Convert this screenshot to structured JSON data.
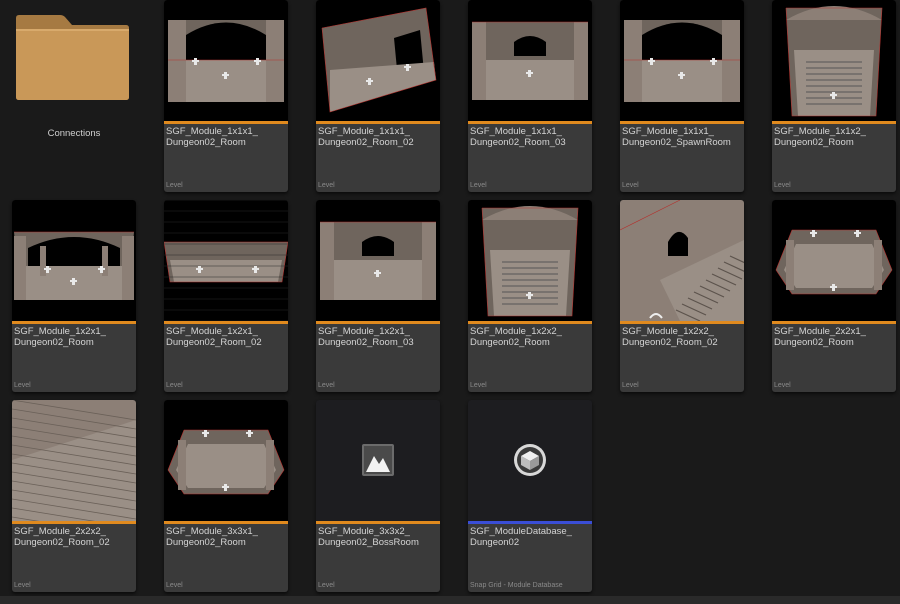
{
  "folder": {
    "label": "Connections",
    "icon": "folder-icon"
  },
  "accent_colors": {
    "level": "#e08a1e",
    "database": "#3a4ed6"
  },
  "assets": [
    {
      "line1": "SGF_Module_1x1x1_",
      "line2": "Dungeon02_Room",
      "type": "Level",
      "thumb": "room-arch"
    },
    {
      "line1": "SGF_Module_1x1x1_",
      "line2": "Dungeon02_Room_02",
      "type": "Level",
      "thumb": "room-tilt"
    },
    {
      "line1": "SGF_Module_1x1x1_",
      "line2": "Dungeon02_Room_03",
      "type": "Level",
      "thumb": "room-pillars"
    },
    {
      "line1": "SGF_Module_1x1x1_",
      "line2": "Dungeon02_SpawnRoom",
      "type": "Level",
      "thumb": "room-arch"
    },
    {
      "line1": "SGF_Module_1x1x2_",
      "line2": "Dungeon02_Room",
      "type": "Level",
      "thumb": "room-tall"
    },
    {
      "line1": "SGF_Module_1x2x1_",
      "line2": "Dungeon02_Room",
      "type": "Level",
      "thumb": "room-colonnade"
    },
    {
      "line1": "SGF_Module_1x2x1_",
      "line2": "Dungeon02_Room_02",
      "type": "Level",
      "thumb": "room-wide"
    },
    {
      "line1": "SGF_Module_1x2x1_",
      "line2": "Dungeon02_Room_03",
      "type": "Level",
      "thumb": "room-pillars"
    },
    {
      "line1": "SGF_Module_1x2x2_",
      "line2": "Dungeon02_Room",
      "type": "Level",
      "thumb": "room-tall"
    },
    {
      "line1": "SGF_Module_1x2x2_",
      "line2": "Dungeon02_Room_02",
      "type": "Level",
      "thumb": "room-stairs"
    },
    {
      "line1": "SGF_Module_2x2x1_",
      "line2": "Dungeon02_Room",
      "type": "Level",
      "thumb": "room-hex"
    },
    {
      "line1": "SGF_Module_2x2x2_",
      "line2": "Dungeon02_Room_02",
      "type": "Level",
      "thumb": "room-closeup"
    },
    {
      "line1": "SGF_Module_3x3x1_",
      "line2": "Dungeon02_Room",
      "type": "Level",
      "thumb": "room-hex"
    },
    {
      "line1": "SGF_Module_3x3x2_",
      "line2": "Dungeon02_BossRoom",
      "type": "Level",
      "thumb": "level-icon"
    },
    {
      "line1": "SGF_ModuleDatabase_",
      "line2": "Dungeon02",
      "type": "Snap Grid - Module Database",
      "thumb": "database-icon"
    }
  ]
}
